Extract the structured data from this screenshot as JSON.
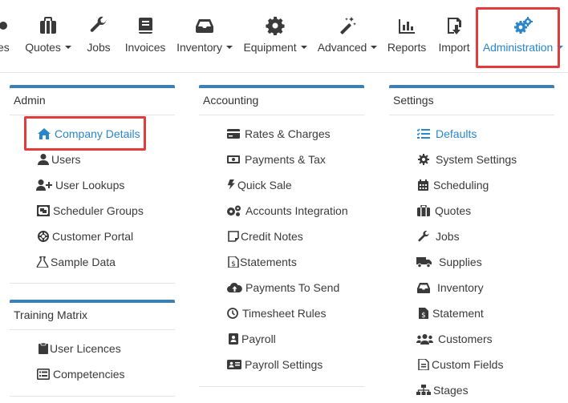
{
  "nav": {
    "items": [
      {
        "label": "ies",
        "caret": false
      },
      {
        "label": "Quotes",
        "caret": true
      },
      {
        "label": "Jobs",
        "caret": false
      },
      {
        "label": "Invoices",
        "caret": false
      },
      {
        "label": "Inventory",
        "caret": true
      },
      {
        "label": "Equipment",
        "caret": true
      },
      {
        "label": "Advanced",
        "caret": true
      },
      {
        "label": "Reports",
        "caret": false
      },
      {
        "label": "Import",
        "caret": false
      },
      {
        "label": "Administration",
        "caret": true
      }
    ],
    "active_color": "#2a86c9"
  },
  "admin": {
    "title": "Admin",
    "items": [
      {
        "label": "Company Details",
        "icon": "home-icon"
      },
      {
        "label": "Users",
        "icon": "user-icon"
      },
      {
        "label": "User Lookups",
        "icon": "user-plus-icon"
      },
      {
        "label": "Scheduler Groups",
        "icon": "object-group-icon"
      },
      {
        "label": "Customer Portal",
        "icon": "life-ring-icon"
      },
      {
        "label": "Sample Data",
        "icon": "flask-icon"
      }
    ]
  },
  "training": {
    "title": "Training Matrix",
    "items": [
      {
        "label": "User Licences",
        "icon": "clipboard-icon"
      },
      {
        "label": "Competencies",
        "icon": "list-alt-icon"
      }
    ]
  },
  "accounting": {
    "title": "Accounting",
    "items": [
      {
        "label": "Rates & Charges",
        "icon": "credit-card-icon"
      },
      {
        "label": "Payments & Tax",
        "icon": "money-bill-icon"
      },
      {
        "label": "Quick Sale",
        "icon": "bolt-icon"
      },
      {
        "label": "Accounts Integration",
        "icon": "cogs-icon"
      },
      {
        "label": "Credit Notes",
        "icon": "sticky-note-icon"
      },
      {
        "label": "Statements",
        "icon": "file-invoice-icon"
      },
      {
        "label": "Payments To Send",
        "icon": "cloud-upload-icon"
      },
      {
        "label": "Timesheet Rules",
        "icon": "clock-icon"
      },
      {
        "label": "Payroll",
        "icon": "address-book-icon"
      },
      {
        "label": "Payroll Settings",
        "icon": "id-card-icon"
      }
    ]
  },
  "settings": {
    "title": "Settings",
    "items": [
      {
        "label": "Defaults",
        "icon": "tasks-icon"
      },
      {
        "label": "System Settings",
        "icon": "cog-icon"
      },
      {
        "label": "Scheduling",
        "icon": "calendar-icon"
      },
      {
        "label": "Quotes",
        "icon": "briefcase-icon"
      },
      {
        "label": "Jobs",
        "icon": "wrench-icon"
      },
      {
        "label": "Supplies",
        "icon": "truck-icon"
      },
      {
        "label": "Inventory",
        "icon": "inbox-icon"
      },
      {
        "label": "Statement",
        "icon": "file-invoice-dollar-icon"
      },
      {
        "label": "Customers",
        "icon": "users-icon"
      },
      {
        "label": "Custom Fields",
        "icon": "file-alt-icon"
      },
      {
        "label": "Stages",
        "icon": "sitemap-icon"
      }
    ]
  }
}
